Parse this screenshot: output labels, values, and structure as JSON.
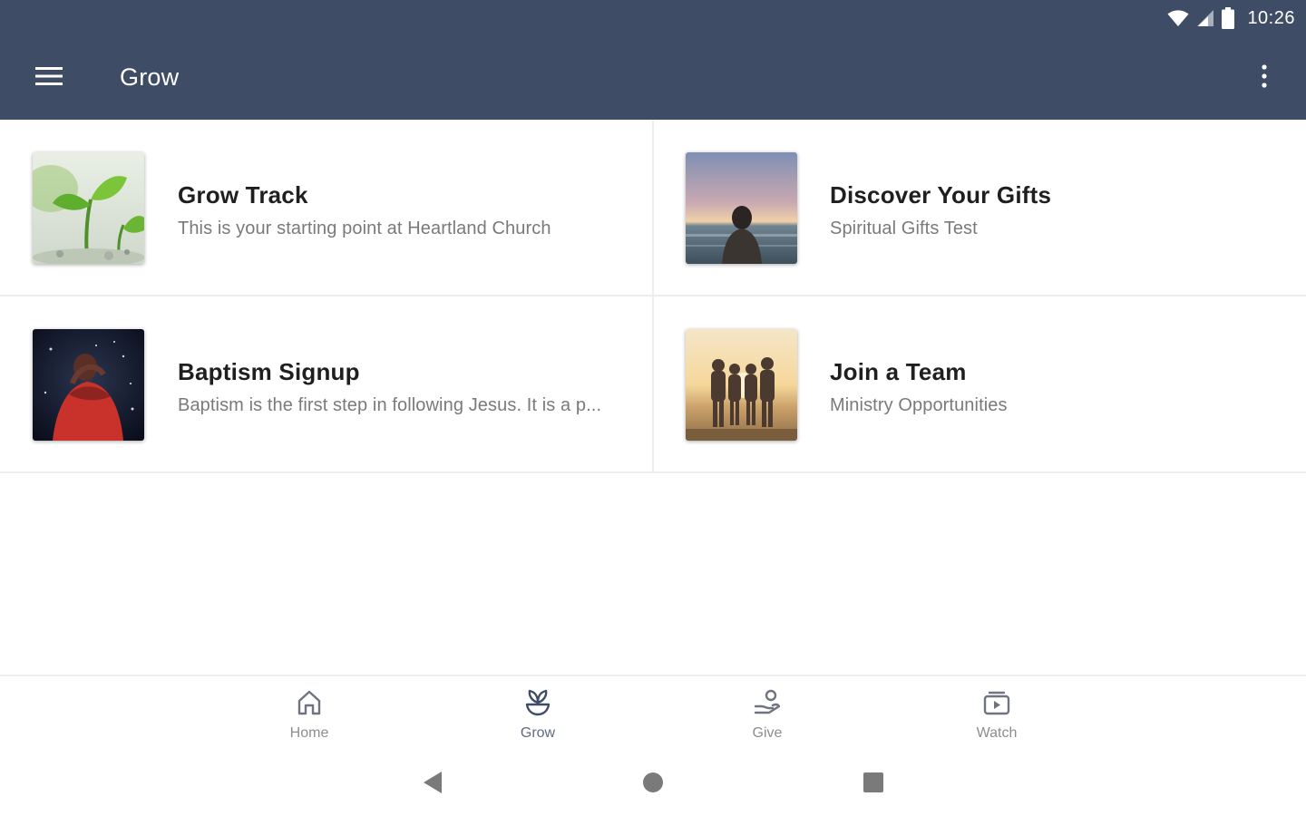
{
  "status_bar": {
    "time": "10:26"
  },
  "app_bar": {
    "title": "Grow"
  },
  "cards": [
    {
      "title": "Grow Track",
      "subtitle": "This is your starting point at Heartland Church",
      "image": "plant-sprouts-photo"
    },
    {
      "title": "Discover Your Gifts",
      "subtitle": "Spiritual Gifts Test",
      "image": "person-at-beach-photo"
    },
    {
      "title": "Baptism Signup",
      "subtitle": "Baptism is the first step in following Jesus. It is a p...",
      "image": "person-in-water-photo"
    },
    {
      "title": "Join a Team",
      "subtitle": "Ministry Opportunities",
      "image": "group-at-sunset-photo"
    }
  ],
  "bottom_nav": {
    "items": [
      {
        "label": "Home",
        "icon": "home-icon"
      },
      {
        "label": "Grow",
        "icon": "sprout-icon",
        "active": true
      },
      {
        "label": "Give",
        "icon": "giving-hand-icon"
      },
      {
        "label": "Watch",
        "icon": "play-box-icon"
      }
    ]
  },
  "system_nav": {
    "buttons": [
      "back-icon",
      "home-circle-icon",
      "recents-square-icon"
    ]
  },
  "colors": {
    "app_bar": "#3f4c66",
    "title_text": "#1f1f1f",
    "subtitle_text": "#7a7a7a",
    "nav_inactive": "#8d8d8d",
    "nav_active": "#3f4c66"
  }
}
